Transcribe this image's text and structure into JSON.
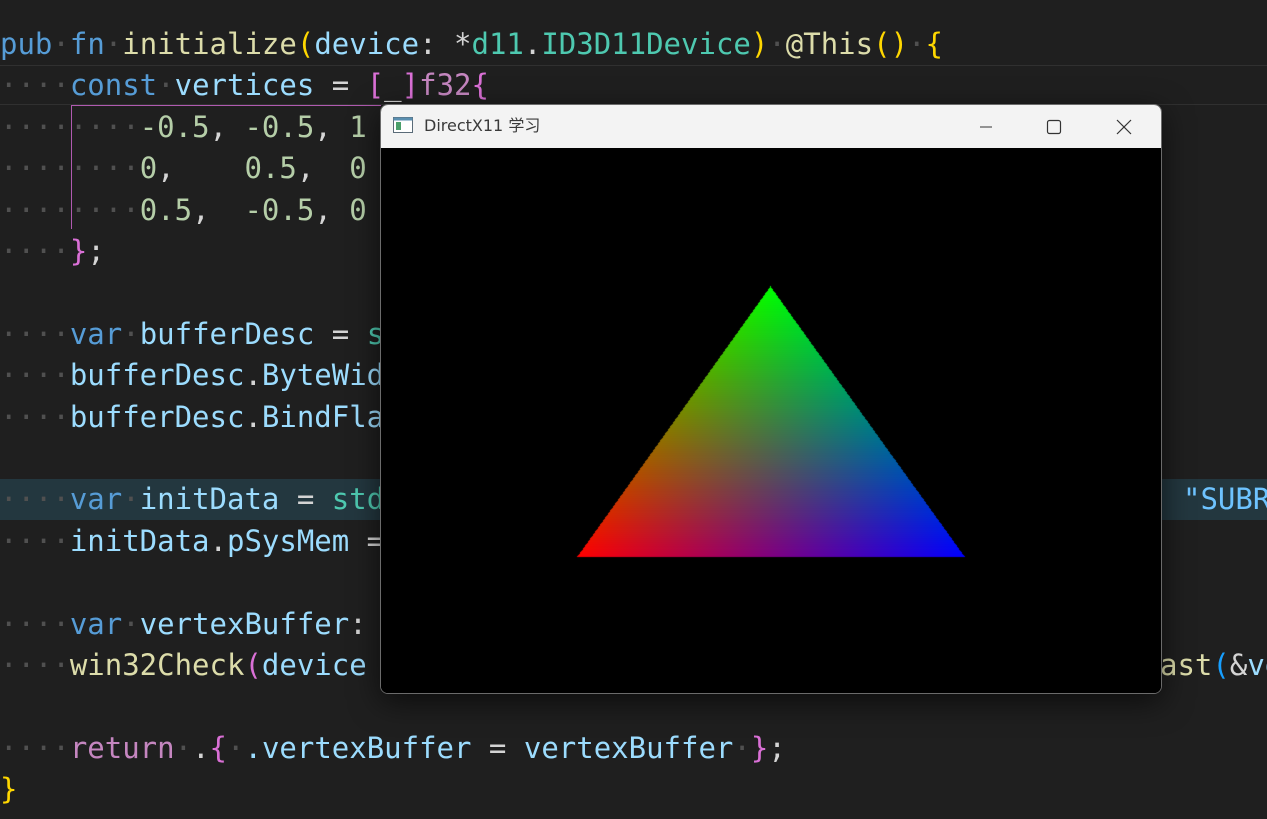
{
  "editor": {
    "lines": [
      {
        "indent": 0,
        "tokens": [
          [
            "pub",
            "kw"
          ],
          [
            " ",
            "ws"
          ],
          [
            "fn",
            "kw"
          ],
          [
            " ",
            "ws"
          ],
          [
            "initialize",
            "fn"
          ],
          [
            "(",
            "b1"
          ],
          [
            "device",
            "id"
          ],
          [
            ": ",
            "pl"
          ],
          [
            "*",
            "pl"
          ],
          [
            "d11",
            "ty"
          ],
          [
            ".",
            "pl"
          ],
          [
            "ID3D11Device",
            "ty"
          ],
          [
            ")",
            "b1"
          ],
          [
            " ",
            "ws"
          ],
          [
            "@This",
            "fn"
          ],
          [
            "()",
            "b1"
          ],
          [
            " ",
            "ws"
          ],
          [
            "{",
            "b1"
          ]
        ]
      },
      {
        "indent": 1,
        "tokens": [
          [
            "const",
            "kw"
          ],
          [
            " ",
            "ws"
          ],
          [
            "vertices",
            "id"
          ],
          [
            " = ",
            "pl"
          ],
          [
            "[",
            "b2"
          ],
          [
            "_",
            "pl"
          ],
          [
            "]",
            "b2"
          ],
          [
            "f32",
            "kw2"
          ],
          [
            "{",
            "b2"
          ]
        ]
      },
      {
        "indent": 2,
        "tokens": [
          [
            "-0.5",
            "nm"
          ],
          [
            ", ",
            "pl"
          ],
          [
            "-0.5",
            "nm"
          ],
          [
            ", ",
            "pl"
          ],
          [
            "1",
            "nm"
          ]
        ]
      },
      {
        "indent": 2,
        "tokens": [
          [
            "0",
            "nm"
          ],
          [
            ",    ",
            "pl"
          ],
          [
            "0.5",
            "nm"
          ],
          [
            ",  ",
            "pl"
          ],
          [
            "0",
            "nm"
          ]
        ]
      },
      {
        "indent": 2,
        "tokens": [
          [
            "0.5",
            "nm"
          ],
          [
            ",  ",
            "pl"
          ],
          [
            "-0.5",
            "nm"
          ],
          [
            ", ",
            "pl"
          ],
          [
            "0",
            "nm"
          ]
        ]
      },
      {
        "indent": 1,
        "tokens": [
          [
            "}",
            "b2"
          ],
          [
            ";",
            "pl"
          ]
        ]
      },
      {
        "indent": 0,
        "tokens": []
      },
      {
        "indent": 1,
        "tokens": [
          [
            "var",
            "kw"
          ],
          [
            " ",
            "ws"
          ],
          [
            "bufferDesc",
            "id"
          ],
          [
            " = ",
            "pl"
          ],
          [
            "s",
            "ty"
          ]
        ]
      },
      {
        "indent": 1,
        "tokens": [
          [
            "bufferDesc",
            "id"
          ],
          [
            ".",
            "pl"
          ],
          [
            "ByteWid",
            "id"
          ]
        ]
      },
      {
        "indent": 1,
        "tokens": [
          [
            "bufferDesc",
            "id"
          ],
          [
            ".",
            "pl"
          ],
          [
            "BindFla",
            "id"
          ]
        ]
      },
      {
        "indent": 0,
        "tokens": []
      },
      {
        "indent": 1,
        "highlight": true,
        "tokens": [
          [
            "var",
            "kw"
          ],
          [
            " ",
            "ws"
          ],
          [
            "initData",
            "id"
          ],
          [
            " = ",
            "pl"
          ],
          [
            "std",
            "ty"
          ]
        ],
        "tail": "\"SUBR"
      },
      {
        "indent": 1,
        "tokens": [
          [
            "initData",
            "id"
          ],
          [
            ".",
            "pl"
          ],
          [
            "pSysMem",
            "id"
          ],
          [
            " =",
            "pl"
          ]
        ]
      },
      {
        "indent": 0,
        "tokens": []
      },
      {
        "indent": 1,
        "tokens": [
          [
            "var",
            "kw"
          ],
          [
            " ",
            "ws"
          ],
          [
            "vertexBuffer",
            "id"
          ],
          [
            ":",
            "pl"
          ]
        ]
      },
      {
        "indent": 1,
        "tokens": [
          [
            "win32Check",
            "fn"
          ],
          [
            "(",
            "b2"
          ],
          [
            "device",
            "id"
          ]
        ],
        "tail2": "ast(&ve"
      },
      {
        "indent": 0,
        "tokens": []
      },
      {
        "indent": 1,
        "tokens": [
          [
            "return",
            "kw2"
          ],
          [
            " ",
            "ws"
          ],
          [
            ".",
            "pl"
          ],
          [
            "{",
            "b2"
          ],
          [
            " ",
            "ws"
          ],
          [
            ".vertexBuffer",
            "id"
          ],
          [
            " = ",
            "pl"
          ],
          [
            "vertexBuffer",
            "id"
          ],
          [
            " ",
            "ws"
          ],
          [
            "}",
            "b2"
          ],
          [
            ";",
            "pl"
          ]
        ]
      },
      {
        "indent": 0,
        "tokens": [
          [
            "}",
            "b1"
          ]
        ]
      }
    ]
  },
  "window": {
    "title": "DirectX11 学习",
    "icon": "app-window-icon",
    "minimize_icon": "minimize-icon",
    "maximize_icon": "maximize-icon",
    "close_icon": "close-icon"
  },
  "triangle": {
    "vertices": [
      {
        "name": "top",
        "color": "#00ff00"
      },
      {
        "name": "bottom-left",
        "color": "#ff0000"
      },
      {
        "name": "bottom-right",
        "color": "#0000ff"
      }
    ]
  }
}
